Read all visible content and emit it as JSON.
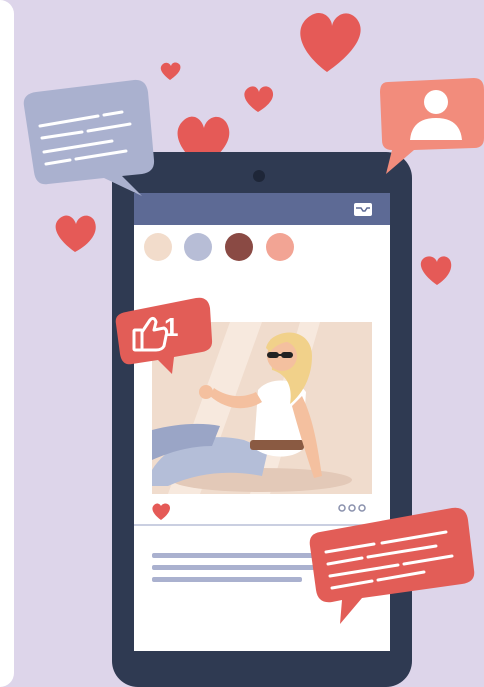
{
  "illustration": {
    "subject": "phone-social-media-post",
    "like_count": "1",
    "colors": {
      "background": "#ddd5ea",
      "phone_body": "#2f3a52",
      "screen": "#ffffff",
      "header_bar": "#5d6a95",
      "heart": "#e55a57",
      "bubble_grey": "#aab1cf",
      "bubble_salmon": "#f28c7c",
      "bubble_red": "#e25d57",
      "photo_bg": "#f0dccd"
    },
    "icons": [
      "heart-icon",
      "thumbs-up-icon",
      "user-icon",
      "inbox-icon",
      "ellipsis-icon"
    ]
  }
}
